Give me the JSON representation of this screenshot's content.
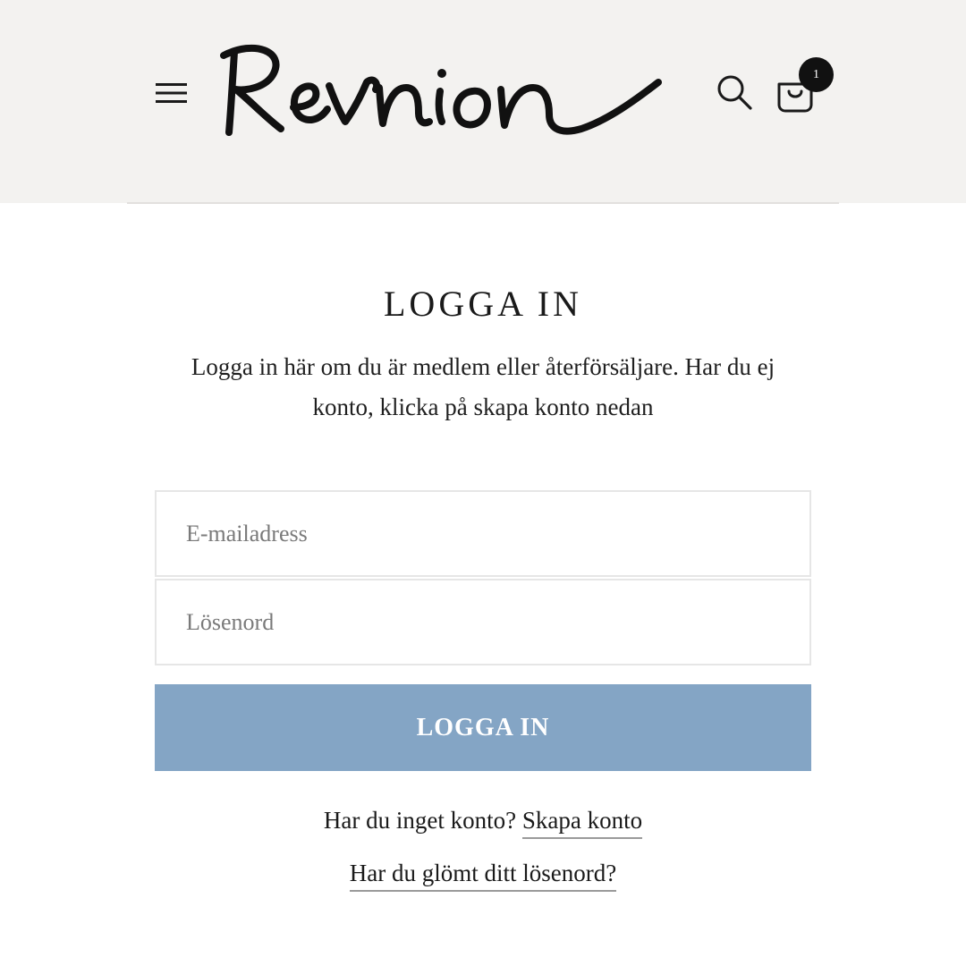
{
  "header": {
    "logo_text": "Revnion",
    "icons": {
      "menu": "hamburger-menu-icon",
      "search": "search-icon",
      "cart": "shopping-bag-icon"
    },
    "cart_count": "1",
    "background": "#f3f2f0"
  },
  "login": {
    "title": "LOGGA IN",
    "intro": "Logga in här om du är medlem eller återförsäljare. Har du ej konto, klicka på skapa konto nedan",
    "email_placeholder": "E-mailadress",
    "email_value": "",
    "password_placeholder": "Lösenord",
    "password_value": "",
    "submit_label": "LOGGA IN",
    "submit_color": "#84a5c5",
    "no_account_text": "Har du inget konto?",
    "create_account_link": "Skapa konto",
    "forgot_password_link": "Har du glömt ditt lösenord?"
  }
}
